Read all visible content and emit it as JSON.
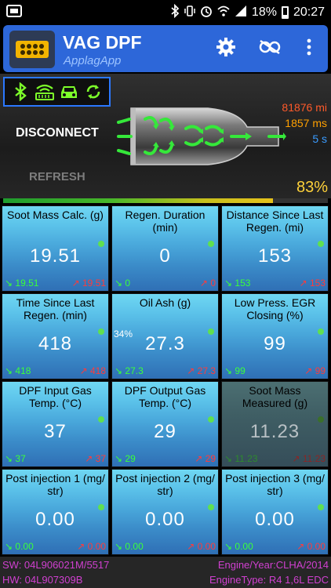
{
  "status_bar": {
    "battery": "18%",
    "time": "20:27",
    "icons": [
      "bluetooth-icon",
      "vibrate-icon",
      "alarm-icon",
      "wifi-icon",
      "signal-icon",
      "battery-icon"
    ]
  },
  "app_bar": {
    "title": "VAG DPF",
    "subtitle": "ApplagApp",
    "color": "#2d67d9",
    "actions": [
      "settings-icon",
      "connection-icon",
      "overflow-menu-icon"
    ]
  },
  "connection": {
    "icons": [
      "bluetooth-icon",
      "adapter-icon",
      "car-icon",
      "sync-icon"
    ],
    "disconnect_label": "DISCONNECT",
    "refresh_label": "REFRESH"
  },
  "stats": {
    "mileage": "81876 mi",
    "latency": "1857 ms",
    "interval": "5 s",
    "progress": "83%",
    "progress_fraction": 0.83
  },
  "tiles": [
    {
      "name": "Soot Mass Calc. (g)",
      "value": "19.51",
      "min": "19.51",
      "max": "19.51",
      "dim": false
    },
    {
      "name": "Regen. Duration (min)",
      "value": "0",
      "min": "0",
      "max": "0",
      "dim": false
    },
    {
      "name": "Distance Since Last Regen. (mi)",
      "value": "153",
      "min": "153",
      "max": "153",
      "dim": false
    },
    {
      "name": "Time Since Last Regen. (min)",
      "value": "418",
      "min": "418",
      "max": "418",
      "dim": false
    },
    {
      "name": "Oil Ash (g)",
      "value": "27.3",
      "min": "27.3",
      "max": "27.3",
      "extra": "34%",
      "dim": false
    },
    {
      "name": "Low Press. EGR Closing (%)",
      "value": "99",
      "min": "99",
      "max": "99",
      "dim": false
    },
    {
      "name": "DPF Input Gas Temp. (°C)",
      "value": "37",
      "min": "37",
      "max": "37",
      "dim": false
    },
    {
      "name": "DPF Output Gas Temp. (°C)",
      "value": "29",
      "min": "29",
      "max": "29",
      "dim": false
    },
    {
      "name": "Soot Mass Measured (g)",
      "value": "11.23",
      "min": "11.23",
      "max": "11.23",
      "dim": true
    },
    {
      "name": "Post injection 1 (mg/ str)",
      "value": "0.00",
      "min": "0.00",
      "max": "0.00",
      "dim": false
    },
    {
      "name": "Post injection 2 (mg/ str)",
      "value": "0.00",
      "min": "0.00",
      "max": "0.00",
      "dim": false
    },
    {
      "name": "Post injection 3 (mg/ str)",
      "value": "0.00",
      "min": "0.00",
      "max": "0.00",
      "dim": false
    }
  ],
  "footer": {
    "sw": "SW: 04L906021M/5517",
    "hw": "HW: 04L907309B",
    "engine_year": "Engine/Year:CLHA/2014",
    "engine_type": "EngineType: R4 1,6L EDC"
  },
  "colors": {
    "stat_mileage": "#ff5a2a",
    "stat_latency": "#ffa000",
    "stat_interval": "#3a9cff",
    "footer_text": "#d040d0"
  }
}
